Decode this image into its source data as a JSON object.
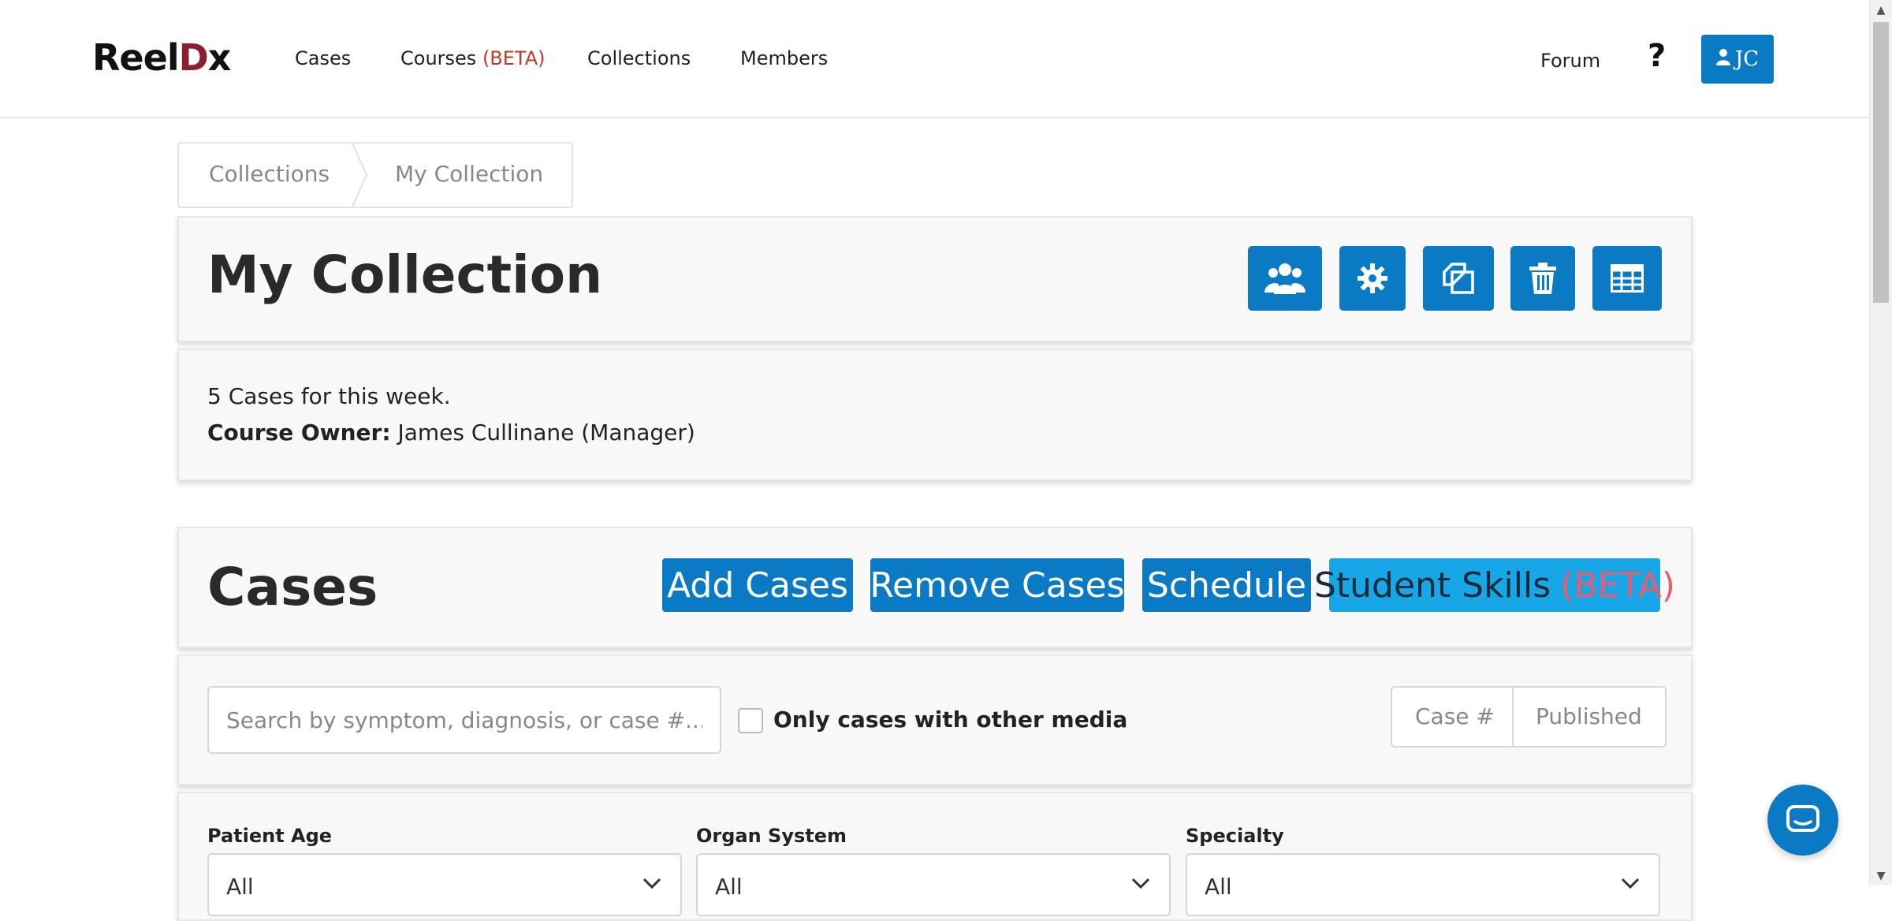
{
  "nav": {
    "logo": {
      "part1": "Reel",
      "part2": "D",
      "part3": "x"
    },
    "links": {
      "cases": "Cases",
      "courses": "Courses",
      "courses_badge": "(BETA)",
      "collections": "Collections",
      "members": "Members"
    },
    "forum": "Forum",
    "help": "?",
    "user_initials": "JC"
  },
  "breadcrumb": {
    "items": [
      "Collections",
      "My Collection"
    ]
  },
  "header": {
    "title": "My Collection",
    "icons": [
      "users-icon",
      "gear-icon",
      "copy-icon",
      "trash-icon",
      "table-icon"
    ]
  },
  "info": {
    "description": "5 Cases for this week.",
    "owner_label": "Course Owner:",
    "owner_value": "James Cullinane (Manager)"
  },
  "cases": {
    "title": "Cases",
    "buttons": {
      "add": "Add Cases",
      "remove": "Remove Cases",
      "schedule": "Schedule",
      "skills": "Student Skills",
      "skills_badge": "(BETA)"
    }
  },
  "search": {
    "placeholder": "Search by symptom, diagnosis, or case #...",
    "value": "",
    "only_media_label": "Only cases with other media",
    "only_media_checked": false,
    "sort_options": [
      "Case #",
      "Published"
    ]
  },
  "filters": [
    {
      "label": "Patient Age",
      "value": "All"
    },
    {
      "label": "Organ System",
      "value": "All"
    },
    {
      "label": "Specialty",
      "value": "All"
    }
  ],
  "colors": {
    "primary": "#0a7ac4",
    "accent_light": "#17a6e6",
    "beta": "#c0392b"
  }
}
